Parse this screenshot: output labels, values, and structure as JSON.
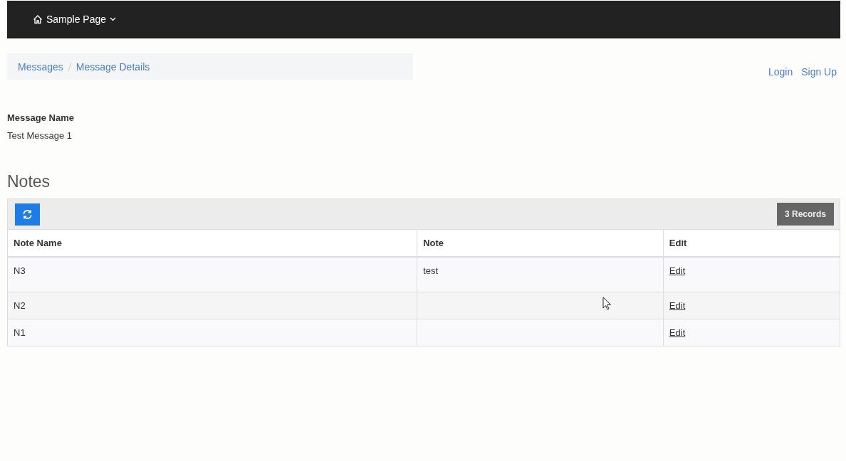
{
  "navbar": {
    "brand": "Sample Page"
  },
  "breadcrumb": [
    "Messages",
    "Message Details"
  ],
  "auth_links": [
    "Login",
    "Sign Up"
  ],
  "field": {
    "label": "Message Name",
    "value": "Test Message 1"
  },
  "notes": {
    "title": "Notes",
    "record_count": "3 Records",
    "columns": [
      "Note Name",
      "Note",
      "Edit"
    ],
    "rows": [
      {
        "note_name": "N3",
        "note": "test",
        "edit": "Edit"
      },
      {
        "note_name": "N2",
        "note": "",
        "edit": "Edit"
      },
      {
        "note_name": "N1",
        "note": "",
        "edit": "Edit"
      }
    ]
  }
}
